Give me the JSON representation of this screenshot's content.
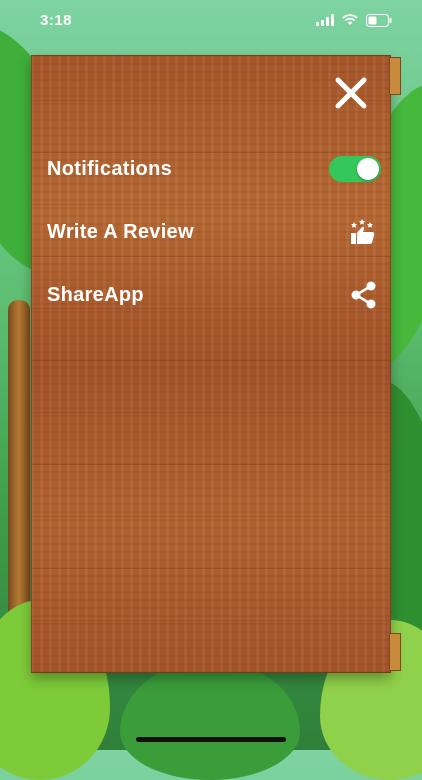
{
  "status_bar": {
    "time": "3:18"
  },
  "panel": {
    "rows": [
      {
        "label": "Notifications",
        "control": "toggle",
        "toggle_on": true
      },
      {
        "label": "Write A Review",
        "icon": "thumbs-up-stars-icon"
      },
      {
        "label": "ShareApp",
        "icon": "share-icon"
      }
    ],
    "close_icon": "close-icon"
  },
  "colors": {
    "toggle_on": "#34c759",
    "wood": "#b0602f",
    "text": "#ffffff"
  }
}
